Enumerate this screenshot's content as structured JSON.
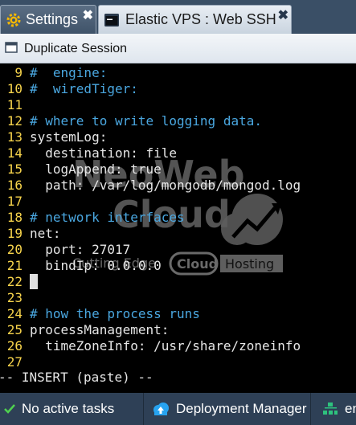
{
  "tabs": [
    {
      "label": "Settings",
      "icon": "settings-gear-icon",
      "close": "✖",
      "active": false
    },
    {
      "label": "Elastic VPS : Web SSH",
      "icon": "terminal-icon",
      "close": "✖",
      "active": true
    }
  ],
  "toolbar": {
    "duplicate_label": "Duplicate Session",
    "icon": "duplicate-window-icon"
  },
  "terminal": {
    "lines": [
      {
        "num": "9",
        "text": "#  engine:",
        "type": "comment"
      },
      {
        "num": "10",
        "text": "#  wiredTiger:",
        "type": "comment"
      },
      {
        "num": "11",
        "text": "",
        "type": "code"
      },
      {
        "num": "12",
        "text": "# where to write logging data.",
        "type": "comment"
      },
      {
        "num": "13",
        "text": "systemLog:",
        "type": "code"
      },
      {
        "num": "14",
        "text": "  destination: file",
        "type": "code"
      },
      {
        "num": "15",
        "text": "  logAppend: true",
        "type": "code"
      },
      {
        "num": "16",
        "text": "  path: /var/log/mongodb/mongod.log",
        "type": "code"
      },
      {
        "num": "17",
        "text": "",
        "type": "code"
      },
      {
        "num": "18",
        "text": "# network interfaces",
        "type": "comment"
      },
      {
        "num": "19",
        "text": "net:",
        "type": "code"
      },
      {
        "num": "20",
        "text": "  port: 27017",
        "type": "code"
      },
      {
        "num": "21",
        "text": "  bindIp: 0.0.0.0",
        "type": "code"
      },
      {
        "num": "22",
        "text": "",
        "type": "code"
      },
      {
        "num": "23",
        "text": "",
        "type": "code"
      },
      {
        "num": "24",
        "text": "# how the process runs",
        "type": "comment"
      },
      {
        "num": "25",
        "text": "processManagement:",
        "type": "code"
      },
      {
        "num": "26",
        "text": "  timeZoneInfo: /usr/share/zoneinfo",
        "type": "code"
      },
      {
        "num": "27",
        "text": "",
        "type": "code"
      }
    ],
    "mode_line": "-- INSERT (paste) --",
    "watermark": {
      "line1": "NeoWeb",
      "line2": "Cloud",
      "tagline": "Cutting Edge",
      "badge": "Cloud",
      "badge_suffix": "Hosting"
    }
  },
  "taskbar": {
    "items": [
      {
        "label": "No active tasks",
        "icon": "checkmark-icon"
      },
      {
        "label": "Deployment Manager",
        "icon": "cloud-upload-icon"
      },
      {
        "label": "en",
        "icon": "environment-icon"
      }
    ]
  },
  "colors": {
    "line_number": "#f7d44c",
    "comment": "#4aa7e0",
    "text": "#e6e6e6",
    "tabbar": "#3a4f66",
    "taskbar": "#2e4056"
  }
}
